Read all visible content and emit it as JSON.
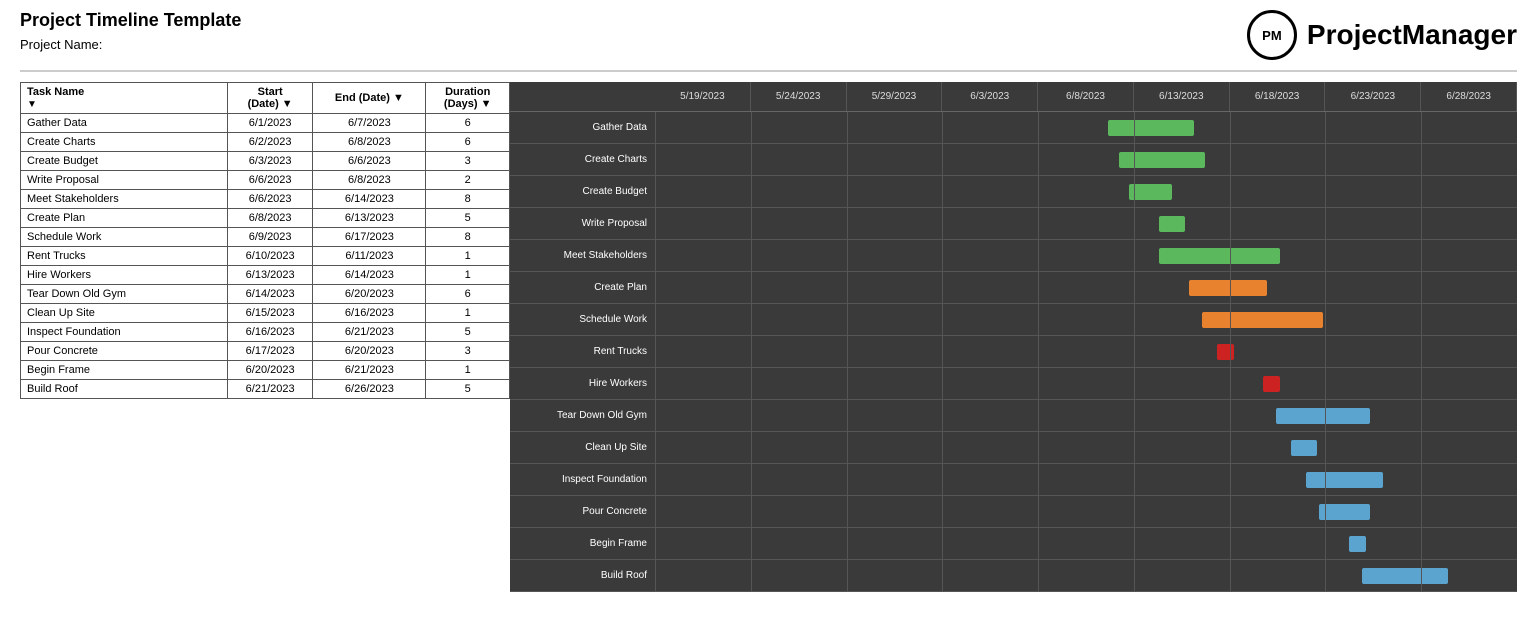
{
  "header": {
    "title": "Project Timeline Template",
    "subtitle": "Project Name:",
    "logo_text": "PM",
    "brand": "ProjectManager"
  },
  "table": {
    "columns": [
      "Task Name",
      "Start\n(Date)",
      "End  (Date)",
      "Duration\n(Days)"
    ],
    "rows": [
      {
        "task": "Gather Data",
        "start": "6/1/2023",
        "end": "6/7/2023",
        "duration": 6
      },
      {
        "task": "Create Charts",
        "start": "6/2/2023",
        "end": "6/8/2023",
        "duration": 6
      },
      {
        "task": "Create Budget",
        "start": "6/3/2023",
        "end": "6/6/2023",
        "duration": 3
      },
      {
        "task": "Write Proposal",
        "start": "6/6/2023",
        "end": "6/8/2023",
        "duration": 2
      },
      {
        "task": "Meet Stakeholders",
        "start": "6/6/2023",
        "end": "6/14/2023",
        "duration": 8
      },
      {
        "task": "Create Plan",
        "start": "6/8/2023",
        "end": "6/13/2023",
        "duration": 5
      },
      {
        "task": "Schedule Work",
        "start": "6/9/2023",
        "end": "6/17/2023",
        "duration": 8
      },
      {
        "task": "Rent Trucks",
        "start": "6/10/2023",
        "end": "6/11/2023",
        "duration": 1
      },
      {
        "task": "Hire Workers",
        "start": "6/13/2023",
        "end": "6/14/2023",
        "duration": 1
      },
      {
        "task": "Tear Down Old Gym",
        "start": "6/14/2023",
        "end": "6/20/2023",
        "duration": 6
      },
      {
        "task": "Clean Up Site",
        "start": "6/15/2023",
        "end": "6/16/2023",
        "duration": 1
      },
      {
        "task": "Inspect Foundation",
        "start": "6/16/2023",
        "end": "6/21/2023",
        "duration": 5
      },
      {
        "task": "Pour Concrete",
        "start": "6/17/2023",
        "end": "6/20/2023",
        "duration": 3
      },
      {
        "task": "Begin Frame",
        "start": "6/20/2023",
        "end": "6/21/2023",
        "duration": 1
      },
      {
        "task": "Build Roof",
        "start": "6/21/2023",
        "end": "6/26/2023",
        "duration": 5
      }
    ]
  },
  "gantt": {
    "date_labels": [
      "5/19/2023",
      "5/24/2023",
      "5/29/2023",
      "6/3/2023",
      "6/8/2023",
      "6/13/2023",
      "6/18/2023",
      "6/23/2023",
      "6/28/2023"
    ],
    "task_labels": [
      "Gather Data",
      "Create Charts",
      "Create Budget",
      "Write Proposal",
      "Meet Stakeholders",
      "Create Plan",
      "Schedule Work",
      "Rent Trucks",
      "Hire Workers",
      "Tear Down Old Gym",
      "Clean Up Site",
      "Inspect Foundation",
      "Pour Concrete",
      "Begin Frame",
      "Build Roof"
    ],
    "bars": [
      {
        "task": "Gather Data",
        "color": "green",
        "left_pct": 52.5,
        "width_pct": 10
      },
      {
        "task": "Create Charts",
        "color": "green",
        "left_pct": 53.8,
        "width_pct": 10
      },
      {
        "task": "Create Budget",
        "color": "green",
        "left_pct": 55.0,
        "width_pct": 5
      },
      {
        "task": "Write Proposal",
        "color": "green",
        "left_pct": 58.5,
        "width_pct": 3
      },
      {
        "task": "Meet Stakeholders",
        "color": "green",
        "left_pct": 58.5,
        "width_pct": 14
      },
      {
        "task": "Create Plan",
        "color": "orange",
        "left_pct": 62.0,
        "width_pct": 9
      },
      {
        "task": "Schedule Work",
        "color": "orange",
        "left_pct": 63.5,
        "width_pct": 14
      },
      {
        "task": "Rent Trucks",
        "color": "red",
        "left_pct": 65.2,
        "width_pct": 2
      },
      {
        "task": "Hire Workers",
        "color": "red",
        "left_pct": 70.5,
        "width_pct": 2
      },
      {
        "task": "Tear Down Old Gym",
        "color": "blue",
        "left_pct": 72.0,
        "width_pct": 11
      },
      {
        "task": "Clean Up Site",
        "color": "blue",
        "left_pct": 73.8,
        "width_pct": 3
      },
      {
        "task": "Inspect Foundation",
        "color": "blue",
        "left_pct": 75.5,
        "width_pct": 9
      },
      {
        "task": "Pour Concrete",
        "color": "blue",
        "left_pct": 77.0,
        "width_pct": 6
      },
      {
        "task": "Begin Frame",
        "color": "blue",
        "left_pct": 80.5,
        "width_pct": 2
      },
      {
        "task": "Build Roof",
        "color": "blue",
        "left_pct": 82.0,
        "width_pct": 10
      }
    ]
  }
}
